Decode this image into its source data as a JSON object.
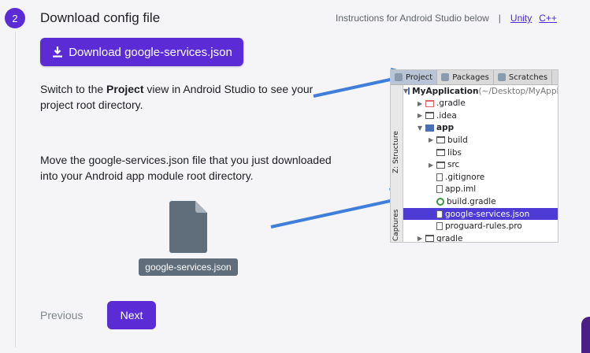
{
  "step": {
    "number": "2",
    "title": "Download config file"
  },
  "platforms": {
    "instructions": "Instructions for Android Studio below",
    "separator": "|",
    "links": [
      "Unity",
      "C++"
    ]
  },
  "download_button": {
    "label": "Download google-services.json"
  },
  "para1": {
    "prefix": "Switch to the ",
    "bold": "Project",
    "suffix": " view in Android Studio to see your project root directory."
  },
  "para2": {
    "text": "Move the google-services.json file that you just downloaded into your Android app module root directory."
  },
  "file_tile": {
    "label": "google-services.json"
  },
  "nav": {
    "previous": "Previous",
    "next": "Next"
  },
  "android_studio": {
    "tabs": [
      "Project",
      "Packages",
      "Scratches"
    ],
    "side_labels": [
      "Z: Structure",
      "Captures"
    ],
    "tree": [
      {
        "label": "MyApplication",
        "suffix": " (~/Desktop/MyApplication)",
        "depth": 0,
        "icon": "folder-blue",
        "expanded": true,
        "bold": true
      },
      {
        "label": ".gradle",
        "depth": 1,
        "icon": "folder-orange",
        "expanded": false
      },
      {
        "label": ".idea",
        "depth": 1,
        "icon": "folder",
        "expanded": false
      },
      {
        "label": "app",
        "depth": 1,
        "icon": "folder-blue",
        "expanded": true,
        "bold": true
      },
      {
        "label": "build",
        "depth": 2,
        "icon": "folder",
        "expanded": false
      },
      {
        "label": "libs",
        "depth": 2,
        "icon": "folder",
        "expanded": null
      },
      {
        "label": "src",
        "depth": 2,
        "icon": "folder",
        "expanded": false
      },
      {
        "label": ".gitignore",
        "depth": 2,
        "icon": "file",
        "expanded": null
      },
      {
        "label": "app.iml",
        "depth": 2,
        "icon": "file",
        "expanded": null
      },
      {
        "label": "build.gradle",
        "depth": 2,
        "icon": "gradle",
        "expanded": null
      },
      {
        "label": "google-services.json",
        "depth": 2,
        "icon": "file",
        "expanded": null,
        "selected": true
      },
      {
        "label": "proguard-rules.pro",
        "depth": 2,
        "icon": "file",
        "expanded": null
      },
      {
        "label": "gradle",
        "depth": 1,
        "icon": "folder",
        "expanded": false
      }
    ]
  },
  "colors": {
    "accent": "#5b2bd6",
    "selection": "#4e3bd6",
    "arrow": "#3f7fd9"
  }
}
